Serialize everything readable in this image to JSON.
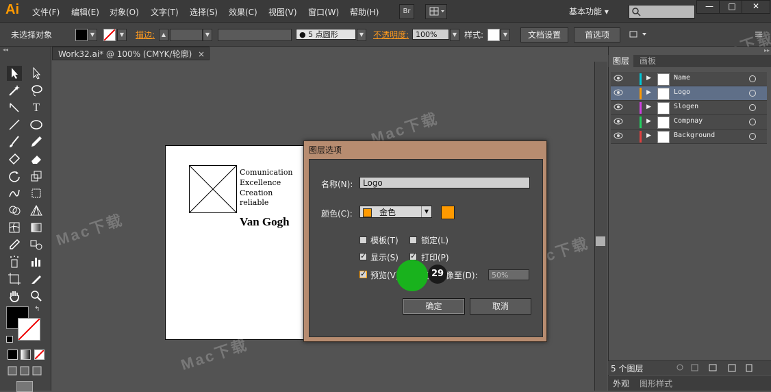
{
  "app": {
    "logo": "Ai"
  },
  "menu": [
    "文件(F)",
    "编辑(E)",
    "对象(O)",
    "文字(T)",
    "选择(S)",
    "效果(C)",
    "视图(V)",
    "窗口(W)",
    "帮助(H)"
  ],
  "menubar": {
    "bridge_label": "Br",
    "workspace": "基本功能",
    "workspace_arrow": "▾"
  },
  "window_controls": {
    "minimize": "—",
    "restore": "□",
    "close": "✕"
  },
  "control_bar": {
    "selection_status": "未选择对象",
    "stroke_label": "描边",
    "brush": "5 点圆形",
    "opacity_label": "不透明度",
    "opacity_value": "100%",
    "style_label": "样式",
    "doc_setup_button": "文档设置",
    "prefs_button": "首选项"
  },
  "document_tab": {
    "title": "Work32.ai* @ 100% (CMYK/轮廓)",
    "close": "×"
  },
  "artboard": {
    "lines": [
      "Comunication",
      "Excellence",
      "Creation",
      "reliable"
    ],
    "name": "Van Gogh"
  },
  "layers_panel": {
    "tabs": [
      "图层",
      "画板"
    ],
    "layers": [
      {
        "name": "Name",
        "color": "#00c8d8",
        "selected": false
      },
      {
        "name": "Logo",
        "color": "#ff9a00",
        "selected": true
      },
      {
        "name": "Slogen",
        "color": "#d040e0",
        "selected": false
      },
      {
        "name": "Compnay",
        "color": "#22d060",
        "selected": false
      },
      {
        "name": "Background",
        "color": "#e04040",
        "selected": false
      }
    ],
    "layer_count": "5 个图层",
    "bottom_tabs": [
      "外观",
      "图形样式"
    ]
  },
  "dialog": {
    "title": "图层选项",
    "name_label": "名称(N):",
    "name_value": "Logo",
    "color_label": "颜色(C):",
    "color_value": "金色",
    "color_hex": "#ff9a00",
    "template_label": "模板(T)",
    "lock_label": "锁定(L)",
    "show_label": "显示(S)",
    "print_label": "打印(P)",
    "preview_label": "预览(V)",
    "dim_label": "变暗图像至(D):",
    "dim_value": "50%",
    "ok_label": "确定",
    "cancel_label": "取消",
    "checks": {
      "template": false,
      "lock": false,
      "show": true,
      "print": true,
      "preview": true,
      "dim": false
    }
  },
  "step_badge": "29",
  "watermark": "Mac下载"
}
